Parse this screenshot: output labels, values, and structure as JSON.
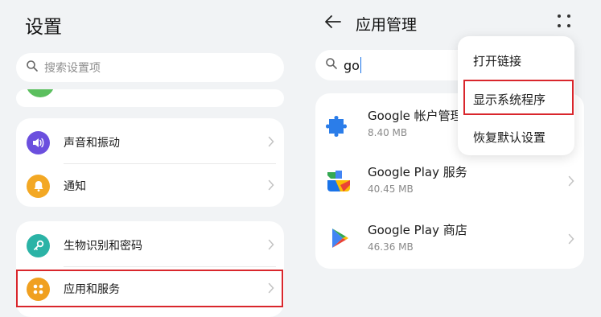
{
  "left_panel": {
    "title": "设置",
    "search_placeholder": "搜索设置项",
    "groups": [
      {
        "items": [
          {
            "label": "声音和振动",
            "icon": "speaker-icon",
            "color": "#6b4fde"
          },
          {
            "label": "通知",
            "icon": "bell-icon",
            "color": "#f3a824"
          }
        ]
      },
      {
        "items": [
          {
            "label": "生物识别和密码",
            "icon": "key-icon",
            "color": "#2bb3a6"
          },
          {
            "label": "应用和服务",
            "icon": "apps-grid-icon",
            "color": "#f0a020",
            "highlighted": true
          }
        ]
      }
    ]
  },
  "right_panel": {
    "title": "应用管理",
    "search_value": "go",
    "apps": [
      {
        "name": "Google 帐户管理",
        "size": "8.40 MB",
        "icon": "puzzle-icon"
      },
      {
        "name": "Google Play 服务",
        "size": "40.45 MB",
        "icon": "play-services-icon"
      },
      {
        "name": "Google Play 商店",
        "size": "46.36 MB",
        "icon": "play-store-icon"
      }
    ],
    "menu": {
      "items": [
        {
          "label": "打开链接"
        },
        {
          "label": "显示系统程序",
          "highlighted": true
        },
        {
          "label": "恢复默认设置"
        }
      ]
    }
  },
  "colors": {
    "background": "#f1f3f5",
    "highlight": "#d9262c",
    "caret": "#1a73e8"
  }
}
